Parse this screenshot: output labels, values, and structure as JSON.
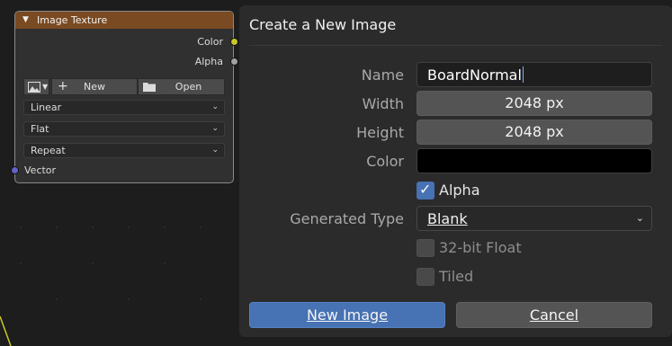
{
  "node": {
    "title": "Image Texture",
    "outputs": [
      "Color",
      "Alpha"
    ],
    "image_picker_icon": "image-icon",
    "new_label": "New",
    "open_label": "Open",
    "interpolation": "Linear",
    "projection": "Flat",
    "extension": "Repeat",
    "input_label": "Vector",
    "socket_colors": {
      "color": "#c7c729",
      "alpha": "#a1a1a1",
      "vector": "#6363c7"
    }
  },
  "dialog": {
    "title": "Create a New Image",
    "name_label": "Name",
    "name_value": "BoardNormal",
    "width_label": "Width",
    "width_value": "2048 px",
    "height_label": "Height",
    "height_value": "2048 px",
    "color_label": "Color",
    "color_value": "#000000",
    "alpha_label": "Alpha",
    "alpha_checked": true,
    "generated_type_label": "Generated Type",
    "generated_type_value": "Blank",
    "float_label": "32-bit Float",
    "float_checked": false,
    "tiled_label": "Tiled",
    "tiled_checked": false,
    "ok_label": "New Image",
    "cancel_label": "Cancel",
    "accent_color": "#4772b3"
  }
}
